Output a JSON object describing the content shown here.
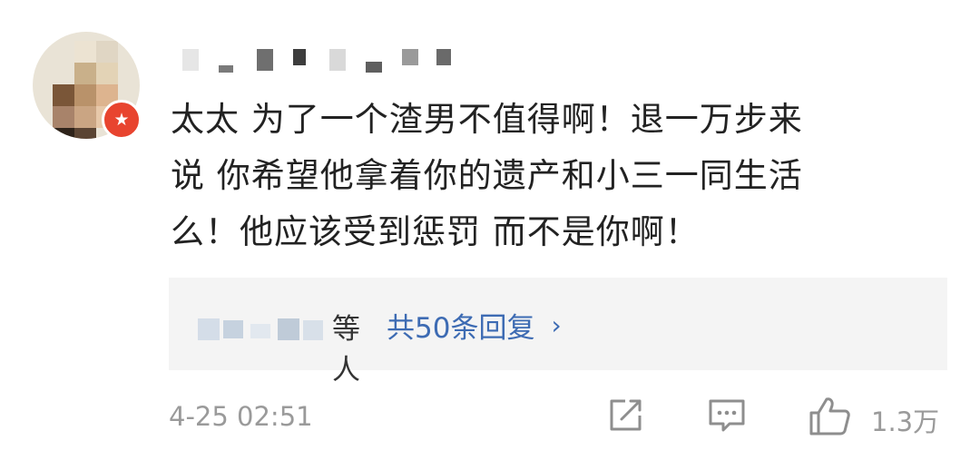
{
  "comment": {
    "lines": [
      "太太 为了一个渣男不值得啊！退一万步来",
      "说 你希望他拿着你的遗产和小三一同生活",
      "么！他应该受到惩罚 而不是你啊！"
    ]
  },
  "replies": {
    "names_tail": "等人",
    "link_label": "共50条回复",
    "chevron": "›"
  },
  "meta": {
    "timestamp": "4-25 02:51",
    "like_count": "1.3万"
  },
  "colors": {
    "link": "#3d6bb3",
    "badge": "#e8442f",
    "meta_text": "#9a9a9a"
  },
  "icons": {
    "share": "share-icon",
    "comment": "comment-icon",
    "like": "thumbs-up-icon",
    "badge": "verified-star-icon"
  }
}
